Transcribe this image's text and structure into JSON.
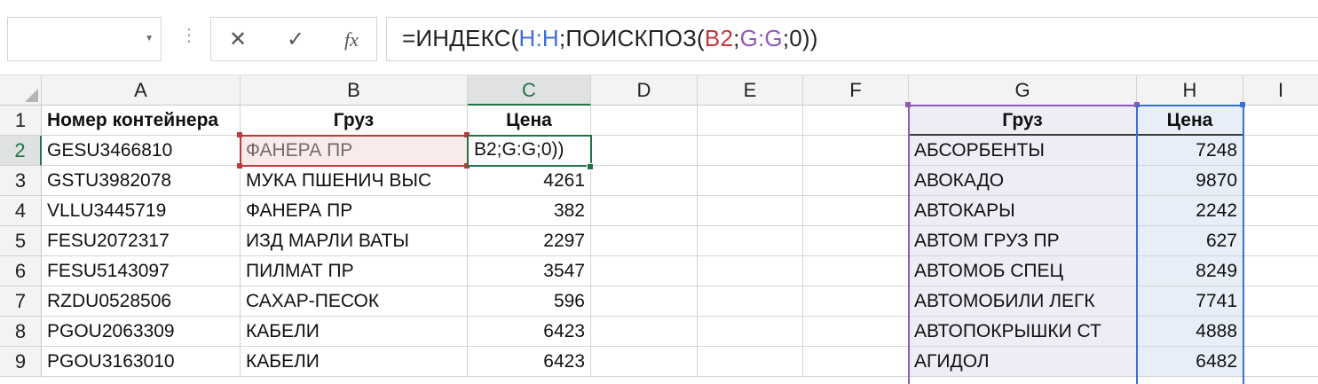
{
  "formula_bar": {
    "name_box": "",
    "cancel_icon": "✕",
    "enter_icon": "✓",
    "fx_label": "fx",
    "formula_parts": [
      "=ИНДЕКС(",
      "H:H",
      ";ПОИСКПОЗ(",
      "B2",
      ";",
      "G:G",
      ";0))"
    ],
    "ref_colors": {
      "H": "#3d6fd6",
      "B2": "#c0393b",
      "G": "#8e59b9"
    }
  },
  "columns": [
    "A",
    "B",
    "C",
    "D",
    "E",
    "F",
    "G",
    "H",
    "I"
  ],
  "rows": [
    "1",
    "2",
    "3",
    "4",
    "5",
    "6",
    "7",
    "8",
    "9"
  ],
  "active_cell_edit_text": "B2;G:G;0))",
  "table_left": {
    "headers": [
      "Номер контейнера",
      "Груз",
      "Цена"
    ],
    "data": [
      [
        "GESU3466810",
        "ФАНЕРА ПР",
        ""
      ],
      [
        "GSTU3982078",
        "МУКА ПШЕНИЧ ВЫС",
        "4261"
      ],
      [
        "VLLU3445719",
        "ФАНЕРА ПР",
        "382"
      ],
      [
        "FESU2072317",
        "ИЗД МАРЛИ ВАТЫ",
        "2297"
      ],
      [
        "FESU5143097",
        "ПИЛМАТ ПР",
        "3547"
      ],
      [
        "RZDU0528506",
        "САХАР-ПЕСОК",
        "596"
      ],
      [
        "PGOU2063309",
        "КАБЕЛИ",
        "6423"
      ],
      [
        "PGOU3163010",
        "КАБЕЛИ",
        "6423"
      ]
    ]
  },
  "table_right": {
    "headers": [
      "Груз",
      "Цена"
    ],
    "data": [
      [
        "АБСОРБЕНТЫ",
        "7248"
      ],
      [
        "АВОКАДО",
        "9870"
      ],
      [
        "АВТОКАРЫ",
        "2242"
      ],
      [
        "АВТОМ ГРУЗ ПР",
        "627"
      ],
      [
        "АВТОМОБ СПЕЦ",
        "8249"
      ],
      [
        "АВТОМОБИЛИ ЛЕГК",
        "7741"
      ],
      [
        "АВТОПОКРЫШКИ СТ",
        "4888"
      ],
      [
        "АГИДОЛ",
        "6482"
      ]
    ]
  }
}
